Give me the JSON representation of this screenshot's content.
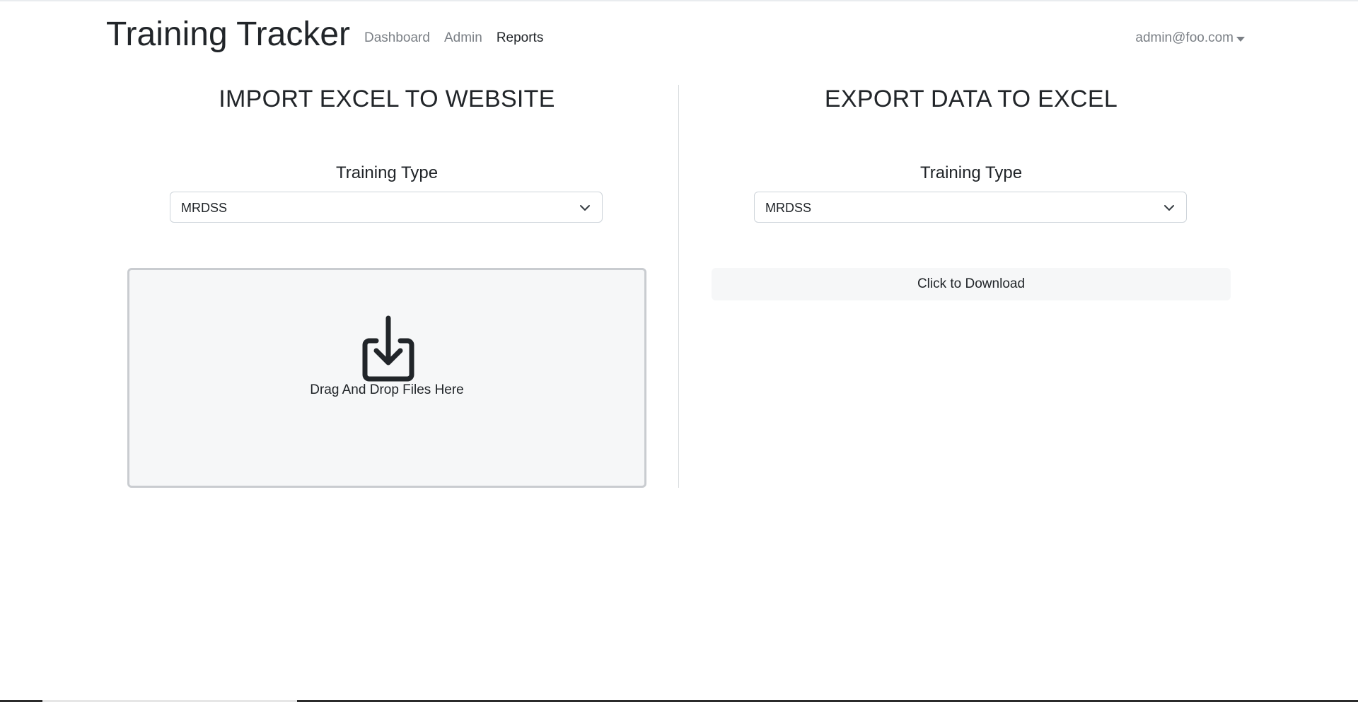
{
  "app": {
    "title": "Training Tracker"
  },
  "nav": {
    "links": [
      {
        "label": "Dashboard"
      },
      {
        "label": "Admin"
      },
      {
        "label": "Reports"
      }
    ],
    "user": "admin@foo.com"
  },
  "import_section": {
    "title": "IMPORT EXCEL TO WEBSITE",
    "field_label": "Training Type",
    "select_value": "MRDSS",
    "dropzone_text": "Drag And Drop Files Here",
    "dropzone_icon": "download-box-icon"
  },
  "export_section": {
    "title": "EXPORT DATA TO EXCEL",
    "field_label": "Training Type",
    "select_value": "MRDSS",
    "download_label": "Click to Download"
  },
  "colors": {
    "muted_text": "#7a7f85",
    "body_text": "#212529",
    "panel_bg": "#f6f7f8",
    "border": "#ced4da"
  }
}
